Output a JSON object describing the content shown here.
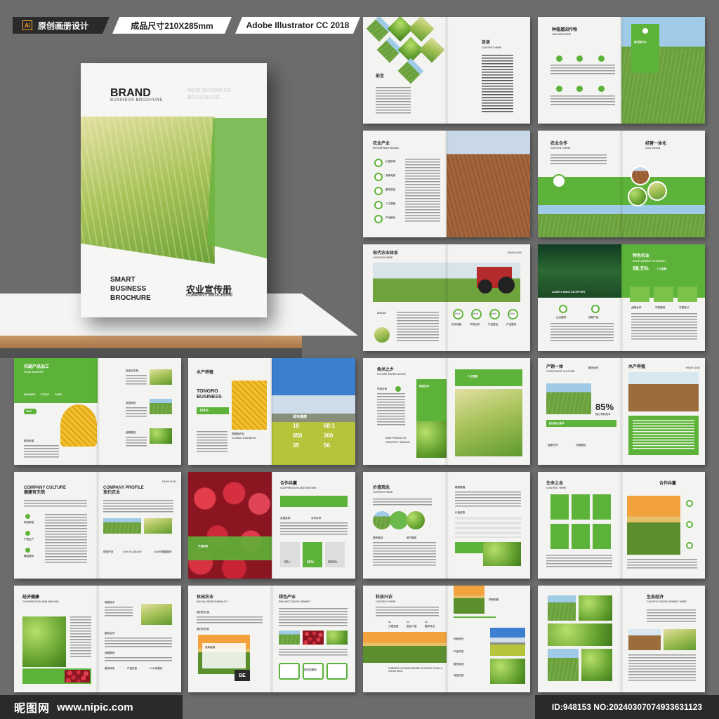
{
  "header": {
    "tag1": "原创画册设计",
    "tag1_icon": "Ai",
    "tag2": "成品尺寸210X285mm",
    "tag3": "Adobe Illustrator CC 2018"
  },
  "cover": {
    "brand": "BRAND",
    "brand_sub": "BUSINESS BROCHURE",
    "new_business": "NEW BUSINESS",
    "new_brochure": "BROCHURE",
    "smart1": "SMART",
    "smart2": "BUSINESS",
    "smart3": "BROCHURE",
    "title_cn": "农业宣传册",
    "title_en": "COMPANY BROCHURE"
  },
  "spreads": {
    "s1": {
      "h1": "前言",
      "h2": "目录",
      "sub": "CONTENT HERE"
    },
    "s2": {
      "h1": "种植基因作物",
      "sub": "OUR SERVICES",
      "box": "我们做什么"
    },
    "s3": {
      "h1": "农业产业",
      "sub": "ENTERPRISE BRAND",
      "i1": "价值导向",
      "i2": "竞争电商",
      "i3": "服务保证",
      "i4": "人工智能",
      "i5": "产业链条"
    },
    "s4": {
      "h1": "农业合作",
      "sub": "CONTENT HERE",
      "h2": "经营一体化",
      "sub2": "OUR VISION"
    },
    "s5": {
      "h1": "现代农业体系",
      "sub": "CONTENT HERE",
      "page": "PAGE 01/02",
      "y1": "2018",
      "y2": "2019",
      "y3": "2020",
      "y4": "2026",
      "l1": "技术创新",
      "l2": "市场分析",
      "l3": "产品层出",
      "l4": "产业服务",
      "brand": "BRAND"
    },
    "s6": {
      "h1": "特色农业",
      "sub": "DEVELOPMENT STRATEGY",
      "pct": "98.5%",
      "pct_label": "人工智能",
      "slogan": "ALWAYS MAKE AN EFFORT",
      "l1": "企业服务",
      "l2": "创新产品",
      "l3": "战略合作",
      "l4": "市场规划",
      "l5": "方案设计"
    },
    "s7": {
      "h1": "农副产品加工",
      "sub": "TEAM WORKER",
      "a": "WONDER",
      "b": "STUDY",
      "c": "CASE",
      "badge": "2020",
      "h2": "规划年度",
      "p1": "标准化实施",
      "p2": "发展目标",
      "p3": "战略规划"
    },
    "s8": {
      "h1": "水产养殖",
      "h2": "TONGRO",
      "h3": "BUSINESS",
      "pct": "135%",
      "h4": "物联网农业",
      "h5": "GLOBAL BUSINESS",
      "g1": "绿色健康",
      "n1": "18",
      "n2": "68:1",
      "n3": "850",
      "n4": "300",
      "n5": "35",
      "n6": "56"
    },
    "s9": {
      "h1": "鱼米之乡",
      "sub": "FUTURE EXPECTATION",
      "a": "市场分析",
      "b": "绿色技术",
      "c": "人工智能",
      "d": "NEW PRODUCTS",
      "e": "CREATIVE / DESIGN"
    },
    "s10": {
      "h1": "产销一体",
      "sub": "CORPORATE CULTURE",
      "h2": "水产养殖",
      "h3": "服务合作",
      "pct": "85%",
      "pct_label": "核心专利技术",
      "page": "PAGE 01/02",
      "bar": "四大核心技术",
      "l1": "经营方式",
      "l2": "方案规划"
    },
    "s11": {
      "h1": "COMPANY CULTURE",
      "h2": "健康有天然",
      "h3": "COMPANY PROFILE",
      "h4": "现代农业",
      "page": "PAGE 01/02",
      "i1": "科技研发",
      "i2": "产品生产",
      "i3": "精品服务",
      "n1": "现场开发",
      "n2": "CNY 65,328,000",
      "n3": "24小时管理服务"
    },
    "s12": {
      "h1": "合作共赢",
      "sub": "COOPERATION AND WIN-WIN",
      "a": "发展目标",
      "b": "合作伙伴",
      "c": "产品生态",
      "v1": "80+",
      "v2": "56%",
      "v3": "8900+",
      "tag": "产品研发"
    },
    "s13": {
      "h1": "价值观念",
      "sub": "CONTENT HERE",
      "a": "精细管理",
      "b": "价值优势",
      "c": "用户服务",
      "d": "服务保证"
    },
    "s14": {
      "h1": "生命之本",
      "sub": "CONTENT HERE",
      "h2": "合作共赢"
    },
    "s15": {
      "h1": "经济健康",
      "sub": "COOPERATION AND WIN-WIN",
      "a": "持续技术",
      "b": "服务合作",
      "c": "战略规划",
      "d": "服务体系",
      "e": "产品优势",
      "f": "24小时服务"
    },
    "s16": {
      "h1": "休闲农业",
      "sub": "SOCIAL RESPONSIBILITY",
      "h2": "绿色产业",
      "sub2": "PROJECT DEVELOPMENT",
      "a": "我们的价值",
      "b": "我们的优势",
      "c": "我们的服务",
      "d": "竞争格局",
      "be": "BE"
    },
    "s17": {
      "h1": "科技兴农",
      "sub": "CONTENT HERE",
      "n1": "01",
      "n2": "02",
      "n3": "03",
      "a": "工程进度",
      "b": "组合介绍",
      "c": "服务专业",
      "d": "THERE'S NOTHING MORE EXCITING THAN A GOOD IDEA",
      "e": "科研创新",
      "f": "科研研究",
      "g": "产品开发",
      "h": "服务系统",
      "i": "绿色天然"
    },
    "s18": {
      "h1": "生态经济",
      "sub": "CONTENT DEVELOPMENT HERE"
    }
  },
  "footer": {
    "logo_cn": "昵图网",
    "logo_url": "www.nipic.com",
    "id_text": "ID:948153 NO:20240307074933631123"
  },
  "colors": {
    "green": "#5db339",
    "dark": "#2a2a2a",
    "bg": "#6c6c6c"
  }
}
